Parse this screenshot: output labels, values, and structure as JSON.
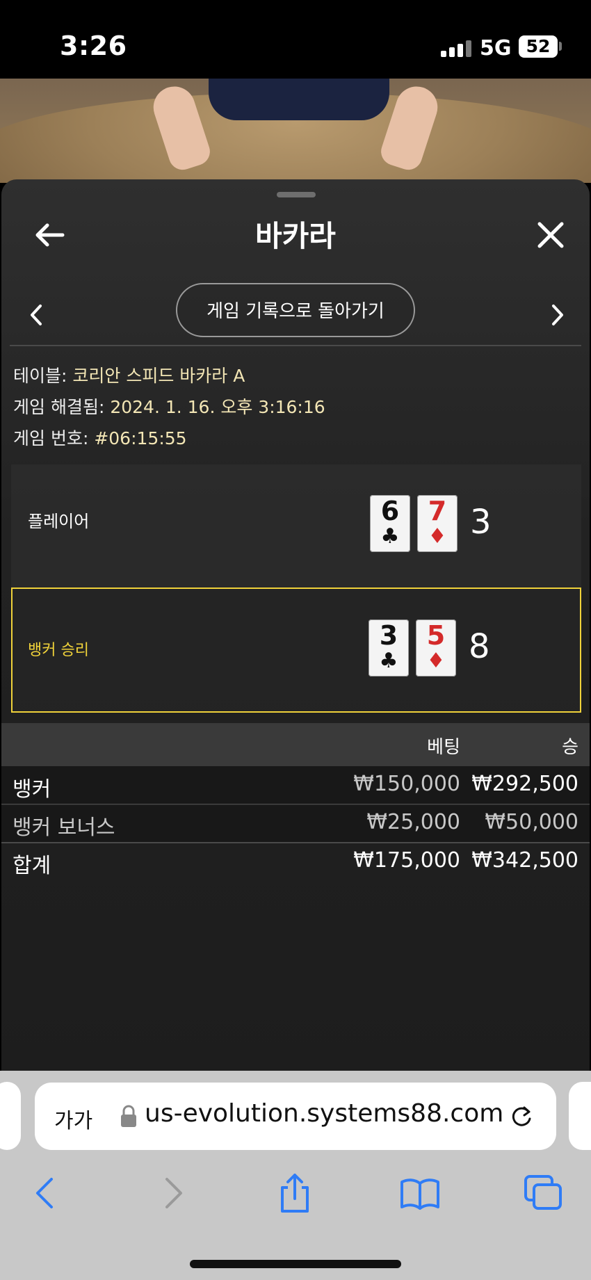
{
  "status_bar": {
    "time": "3:26",
    "network": "5G",
    "battery": "52"
  },
  "header": {
    "title": "바카라"
  },
  "history_button": {
    "label": "게임 기록으로 돌아가기"
  },
  "info": {
    "table_label": "테이블:",
    "table_value": "코리안 스피드 바카라 A",
    "resolved_label": "게임 해결됨:",
    "resolved_value": "2024. 1. 16. 오후 3:16:16",
    "number_label": "게임 번호:",
    "number_value": "#06:15:55"
  },
  "player": {
    "label": "플레이어",
    "cards": [
      {
        "rank": "6",
        "suit": "♣"
      },
      {
        "rank": "7",
        "suit": "♦"
      }
    ],
    "score": "3"
  },
  "banker": {
    "label": "뱅커 승리",
    "cards": [
      {
        "rank": "3",
        "suit": "♣"
      },
      {
        "rank": "5",
        "suit": "♦"
      }
    ],
    "score": "8"
  },
  "bets": {
    "headers": {
      "bet": "베팅",
      "win": "승"
    },
    "rows": [
      {
        "name": "뱅커",
        "bet": "₩150,000",
        "win": "₩292,500"
      },
      {
        "name": "뱅커 보너스",
        "bet": "₩25,000",
        "win": "₩50,000"
      },
      {
        "name": "합계",
        "bet": "₩175,000",
        "win": "₩342,500"
      }
    ]
  },
  "browser": {
    "text_size": "가가",
    "url": "us-evolution.systems88.com"
  },
  "colors": {
    "highlight": "#f0d23a",
    "red_suit": "#d42a2a",
    "sheet_bg": "#222222"
  }
}
